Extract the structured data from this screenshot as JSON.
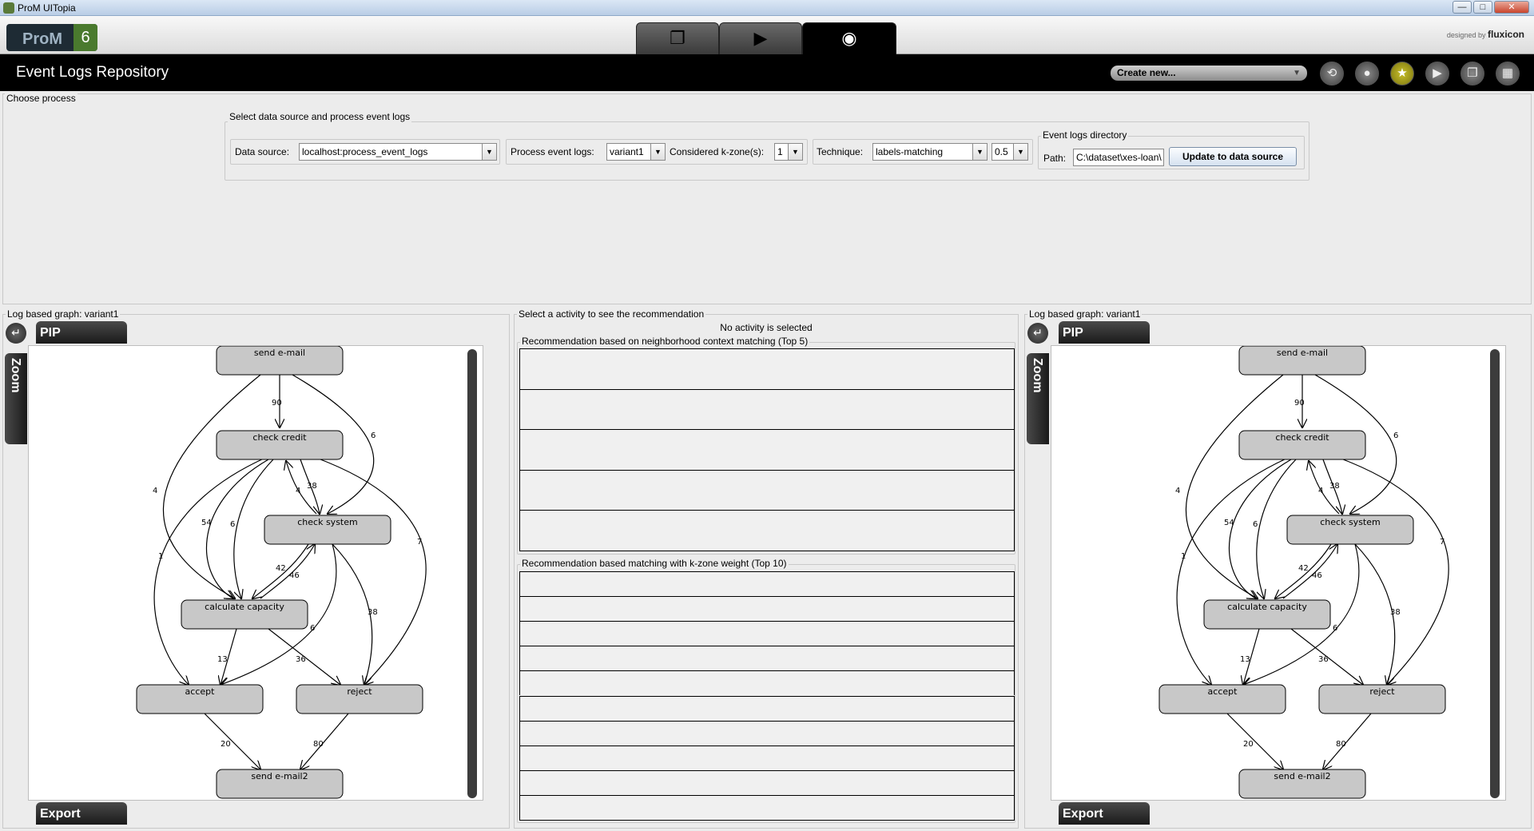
{
  "window": {
    "title": "ProM UITopia",
    "minimize": "—",
    "maximize": "□",
    "close": "✕"
  },
  "header": {
    "logo_text": "ProM",
    "logo_version": "6",
    "tabs": [
      {
        "name": "workspace-tab",
        "icon": "copy-icon",
        "glyph": "❐"
      },
      {
        "name": "actions-tab",
        "icon": "play-icon",
        "glyph": "▶"
      },
      {
        "name": "views-tab",
        "icon": "eye-icon",
        "glyph": "◉"
      }
    ],
    "designed_by": "designed by",
    "brand": "fluxicon"
  },
  "band": {
    "title": "Event Logs Repository",
    "create_new": "Create new...",
    "icons": [
      {
        "name": "refresh-icon",
        "glyph": "⟲"
      },
      {
        "name": "drop-icon",
        "glyph": "●"
      },
      {
        "name": "star-icon",
        "glyph": "★"
      },
      {
        "name": "play-icon",
        "glyph": "▶"
      },
      {
        "name": "copy-icon",
        "glyph": "❐"
      },
      {
        "name": "grid-icon",
        "glyph": "▦"
      }
    ]
  },
  "choose": {
    "legend": "Choose process",
    "select_legend": "Select data source and process event logs",
    "data_source_label": "Data source:",
    "data_source_value": "localhost:process_event_logs",
    "process_logs_label": "Process event logs:",
    "process_logs_value": "variant1",
    "kzone_label": "Considered k-zone(s):",
    "kzone_value": "1",
    "technique_label": "Technique:",
    "technique_value": "labels-matching",
    "threshold_value": "0.5",
    "dir_legend": "Event logs directory",
    "path_label": "Path:",
    "path_value": "C:\\dataset\\xes-loan\\",
    "update_button": "Update to data source"
  },
  "left_graph": {
    "legend": "Log based graph: variant1",
    "pip": "PIP",
    "zoom": "Zoom",
    "export": "Export"
  },
  "right_graph": {
    "legend": "Log based graph: variant1",
    "pip": "PIP",
    "zoom": "Zoom",
    "export": "Export"
  },
  "graph": {
    "nodes": [
      {
        "id": "send-email",
        "label": "send e-mail"
      },
      {
        "id": "check-credit",
        "label": "check credit"
      },
      {
        "id": "check-system",
        "label": "check system"
      },
      {
        "id": "calculate-capacity",
        "label": "calculate capacity"
      },
      {
        "id": "accept",
        "label": "accept"
      },
      {
        "id": "reject",
        "label": "reject"
      },
      {
        "id": "send-email2",
        "label": "send e-mail2"
      }
    ],
    "edge_labels": [
      "90",
      "6",
      "4",
      "38",
      "4",
      "54",
      "6",
      "1",
      "7",
      "42",
      "46",
      "6",
      "38",
      "13",
      "36",
      "20",
      "80"
    ]
  },
  "recommend": {
    "legend": "Select a activity to see the recommendation",
    "status": "No activity is selected",
    "top5_legend": "Recommendation based on neighborhood context matching (Top 5)",
    "top10_legend": "Recommendation based matching with k-zone weight (Top 10)",
    "top5_rows": 5,
    "top10_rows": 10
  }
}
